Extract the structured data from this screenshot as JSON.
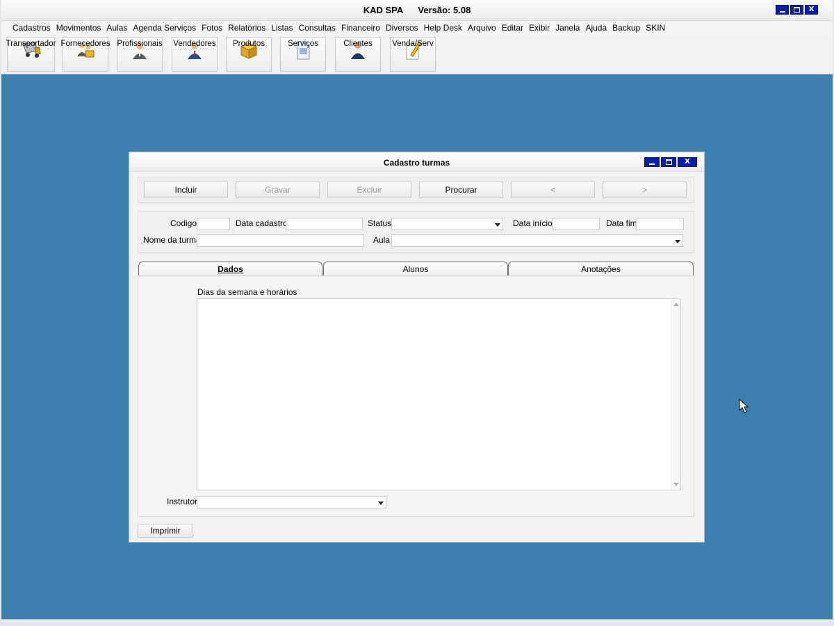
{
  "app": {
    "title": "KAD SPA      Versão: 5.08",
    "window_controls": {
      "minimize": "minimize",
      "maximize": "maximize",
      "close": "X"
    }
  },
  "menu": [
    "Cadastros",
    "Movimentos",
    "Aulas",
    "Agenda Serviços",
    "Fotos",
    "Relatórios",
    "Listas",
    "Consultas",
    "Financeiro",
    "Diversos",
    "Help Desk",
    "Arquivo",
    "Editar",
    "Exibir",
    "Janela",
    "Ajuda",
    "Backup",
    "SKIN"
  ],
  "toolbar": [
    {
      "label": "Transportador",
      "icon": "truck-icon"
    },
    {
      "label": "Fornecedores",
      "icon": "suppliers-icon"
    },
    {
      "label": "Profissionais",
      "icon": "professional-icon"
    },
    {
      "label": "Vendedores",
      "icon": "sellers-icon"
    },
    {
      "label": "Produtos",
      "icon": "box-icon"
    },
    {
      "label": "Serviços",
      "icon": "document-icon"
    },
    {
      "label": "Clientes",
      "icon": "client-icon"
    },
    {
      "label": "Venda/Serv",
      "icon": "pencil-paper-icon"
    }
  ],
  "dialog": {
    "title": "Cadastro turmas",
    "close": "X",
    "actions": {
      "incluir": "Incluir",
      "gravar": "Gravar",
      "excluir": "Excluir",
      "procurar": "Procurar",
      "prev": "<",
      "next": ">"
    },
    "fields": {
      "codigo_label": "Codigo",
      "codigo_value": "",
      "data_cadastro_label": "Data cadastro",
      "data_cadastro_value": "",
      "status_label": "Status",
      "status_value": "",
      "data_inicio_label": "Data início",
      "data_inicio_value": "",
      "data_fim_label": "Data fim",
      "data_fim_value": "",
      "nome_turma_label": "Nome da turma",
      "nome_turma_value": "",
      "aula_label": "Aula",
      "aula_value": ""
    },
    "tabs": [
      {
        "label": "Dados",
        "active": true
      },
      {
        "label": "Alunos",
        "active": false
      },
      {
        "label": "Anotações",
        "active": false
      }
    ],
    "dados": {
      "dias_label": "Dias da semana e horários",
      "dias_value": "",
      "instrutor_label": "Instrutor",
      "instrutor_value": ""
    },
    "imprimir": "Imprimir"
  },
  "colors": {
    "desktop": "#3d7fad",
    "window_button": "#0a1ea6"
  }
}
